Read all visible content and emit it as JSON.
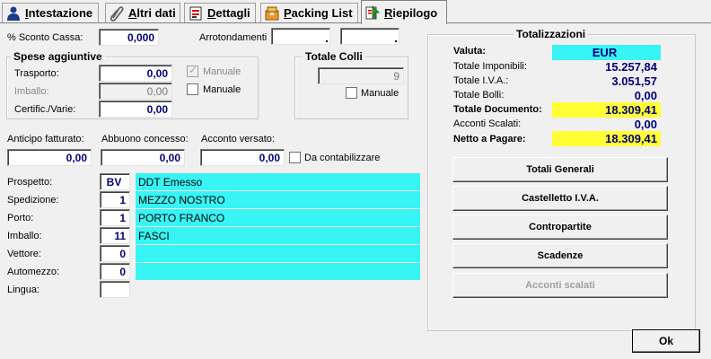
{
  "tabs": [
    {
      "label": "Intestazione",
      "icon": "person-icon"
    },
    {
      "label": "Altri dati",
      "icon": "paperclip-icon"
    },
    {
      "label": "Dettagli",
      "icon": "document-icon"
    },
    {
      "label": "Packing List",
      "icon": "package-icon"
    },
    {
      "label": "Riepilogo",
      "icon": "summary-icon",
      "active": true
    }
  ],
  "sconto_cassa": {
    "label": "% Sconto Cassa:",
    "value": "0,000"
  },
  "arrotondamenti": {
    "label": "Arrotondamenti",
    "value1": "",
    "value2": ""
  },
  "spese": {
    "title": "Spese aggiuntive",
    "trasporto": {
      "label": "Trasporto:",
      "value": "0,00",
      "check_label": "Manuale"
    },
    "imballo": {
      "label": "Imballo:",
      "value": "0,00",
      "check_label": "Manuale"
    },
    "certific": {
      "label": "Certific./Varie:",
      "value": "0,00"
    }
  },
  "colli": {
    "title": "Totale Colli",
    "value": "9",
    "check_label": "Manuale"
  },
  "anticipo": {
    "label": "Anticipo fatturato:",
    "value": "0,00"
  },
  "abbuono": {
    "label": "Abbuono concesso:",
    "value": "0,00"
  },
  "acconto": {
    "label": "Acconto versato:",
    "value": "0,00",
    "check_label": "Da contabilizzare"
  },
  "rows": [
    {
      "label": "Prospetto:",
      "code": "BV",
      "desc": "DDT Emesso"
    },
    {
      "label": "Spedizione:",
      "code": "1",
      "desc": "MEZZO NOSTRO"
    },
    {
      "label": "Porto:",
      "code": "1",
      "desc": "PORTO FRANCO"
    },
    {
      "label": "Imballo:",
      "code": "11",
      "desc": "FASCI"
    },
    {
      "label": "Vettore:",
      "code": "0",
      "desc": ""
    },
    {
      "label": "Automezzo:",
      "code": "0",
      "desc": ""
    },
    {
      "label": "Lingua:",
      "code": "",
      "desc": ""
    }
  ],
  "totali": {
    "title": "Totalizzazioni",
    "valuta": {
      "label": "Valuta:",
      "value": "EUR"
    },
    "imponibili": {
      "label": "Totale Imponibili:",
      "value": "15.257,84"
    },
    "iva": {
      "label": "Totale I.V.A.:",
      "value": "3.051,57"
    },
    "bolli": {
      "label": "Totale Bolli:",
      "value": "0,00"
    },
    "documento": {
      "label": "Totale Documento:",
      "value": "18.309,41"
    },
    "acconti": {
      "label": "Acconti Scalati:",
      "value": "0,00"
    },
    "netto": {
      "label": "Netto a Pagare:",
      "value": "18.309,41"
    }
  },
  "buttons": {
    "totali_generali": "Totali Generali",
    "castelletto": "Castelletto I.V.A.",
    "contropartite": "Contropartite",
    "scadenze": "Scadenze",
    "acconti_scalati": "Acconti scalati",
    "ok": "Ok"
  },
  "colors": {
    "cyan": "#38f4f4",
    "yellow": "#ffff33",
    "value_text": "#00007a"
  }
}
